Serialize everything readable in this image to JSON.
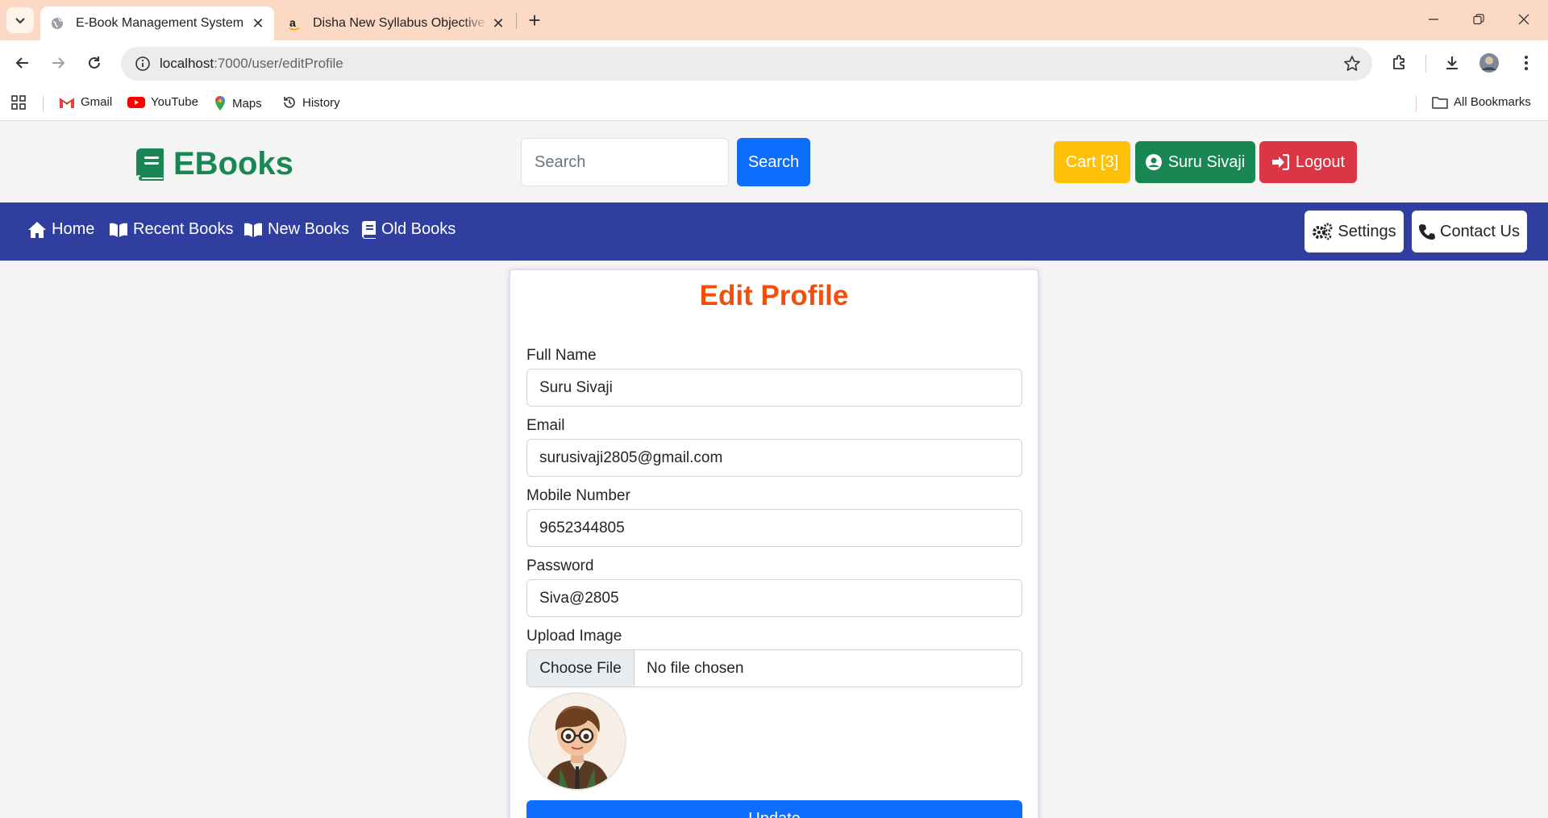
{
  "browser": {
    "tabs": [
      {
        "title": "E-Book Management System",
        "active": true
      },
      {
        "title": "Disha New Syllabus Objective NCERT",
        "active": false
      }
    ],
    "url_host": "localhost",
    "url_path": ":7000/user/editProfile",
    "bookmarks": [
      "Gmail",
      "YouTube",
      "Maps",
      "History"
    ],
    "all_bookmarks": "All Bookmarks"
  },
  "header": {
    "logo_text": "EBooks",
    "search_placeholder": "Search",
    "search_button": "Search",
    "cart_label": "Cart [3]",
    "user_label": "Suru Sivaji",
    "logout_label": "Logout"
  },
  "nav": {
    "items": [
      "Home",
      "Recent Books",
      "New Books",
      "Old Books"
    ],
    "settings": "Settings",
    "contact": "Contact Us"
  },
  "form": {
    "title": "Edit Profile",
    "fullname_label": "Full Name",
    "fullname_value": "Suru Sivaji",
    "email_label": "Email",
    "email_value": "surusivaji2805@gmail.com",
    "mobile_label": "Mobile Number",
    "mobile_value": "9652344805",
    "password_label": "Password",
    "password_value": "Siva@2805",
    "upload_label": "Upload Image",
    "choose_file": "Choose File",
    "no_file": "No file chosen",
    "update_button": "Update"
  },
  "colors": {
    "navbar": "#303f9f",
    "logo": "#198754",
    "title": "#f44e0b",
    "primary": "#0d6efd",
    "warning": "#ffc107",
    "success": "#198754",
    "danger": "#dc3545",
    "tabstrip": "#fcd9c5"
  }
}
